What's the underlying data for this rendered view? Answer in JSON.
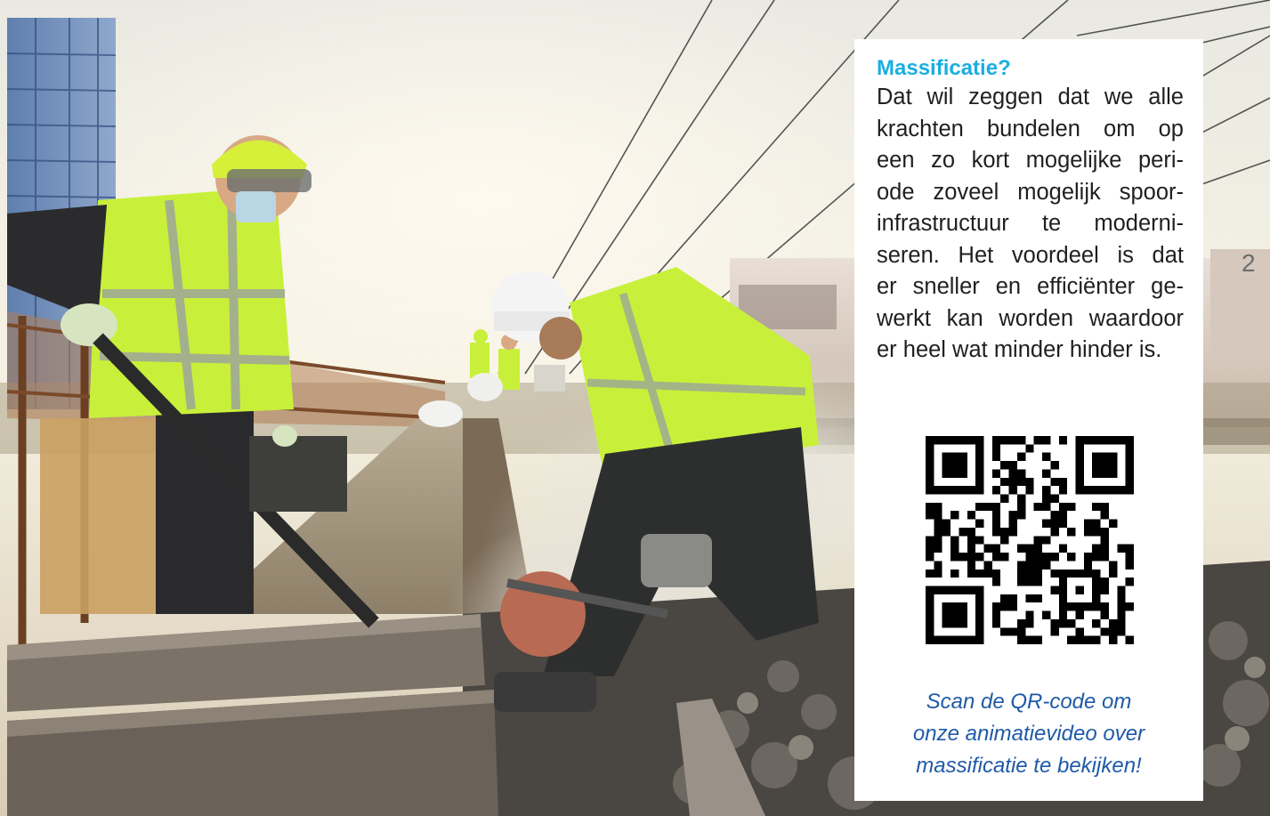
{
  "info": {
    "title": "Massificatie?",
    "body_lines": [
      "Dat wil zeggen dat we alle",
      "krachten bundelen om op",
      "een zo kort mogelijke peri-",
      "ode zoveel mogelijk spoor-",
      "infrastructuur te moderni-",
      "seren. Het voordeel is dat",
      "er sneller en efficiënter ge-",
      "werkt kan worden waardoor",
      "er heel wat minder hinder is."
    ],
    "caption_lines": [
      "Scan de QR-code om",
      "onze animatievideo over",
      "massificatie te bekijken!"
    ]
  },
  "colors": {
    "title": "#1aaee0",
    "caption": "#1f5aa6",
    "body": "#1f1f1f",
    "vest": "#c8f03a"
  }
}
